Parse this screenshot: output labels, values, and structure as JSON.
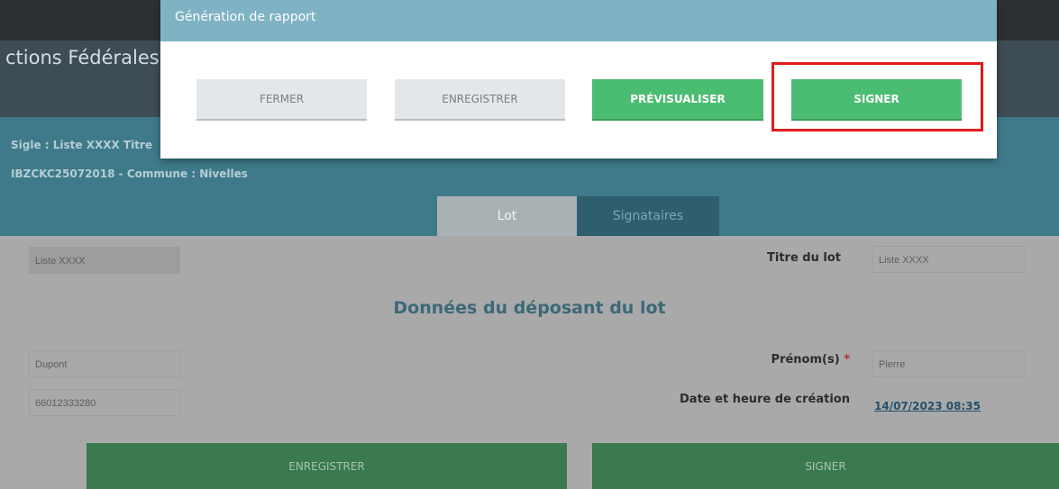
{
  "app": {
    "title_fragment": "ctions Fédérales c"
  },
  "info": {
    "line1": "Sigle : Liste XXXX  Titre",
    "line2": "IBZCKC25072018  - Commune : Nivelles"
  },
  "tabs": [
    {
      "label": "Lot",
      "active": true
    },
    {
      "label": "Signataires",
      "active": false
    }
  ],
  "form": {
    "sigle_value": "Liste XXXX",
    "titre_label": "Titre du lot",
    "titre_value": "Liste XXXX",
    "section_title": "Données du déposant du lot",
    "nom_value": "Dupont",
    "prenom_label": "Prénom(s)",
    "required_mark": "*",
    "prenom_value": "Pierre",
    "registre_value": "66012333280",
    "date_label": "Date et heure de création",
    "date_value": "14/07/2023 08:35",
    "save_label": "ENREGISTRER",
    "sign_label": "SIGNER"
  },
  "modal": {
    "title": "Génération de rapport",
    "buttons": {
      "close": "FERMER",
      "save": "ENREGISTRER",
      "preview": "PRÉVISUALISER",
      "sign": "SIGNER"
    },
    "highlighted_button": "sign"
  },
  "colors": {
    "modal_header": "#7fb3c4",
    "primary_green": "#4bbd72",
    "highlight_red": "#e01b1b"
  }
}
